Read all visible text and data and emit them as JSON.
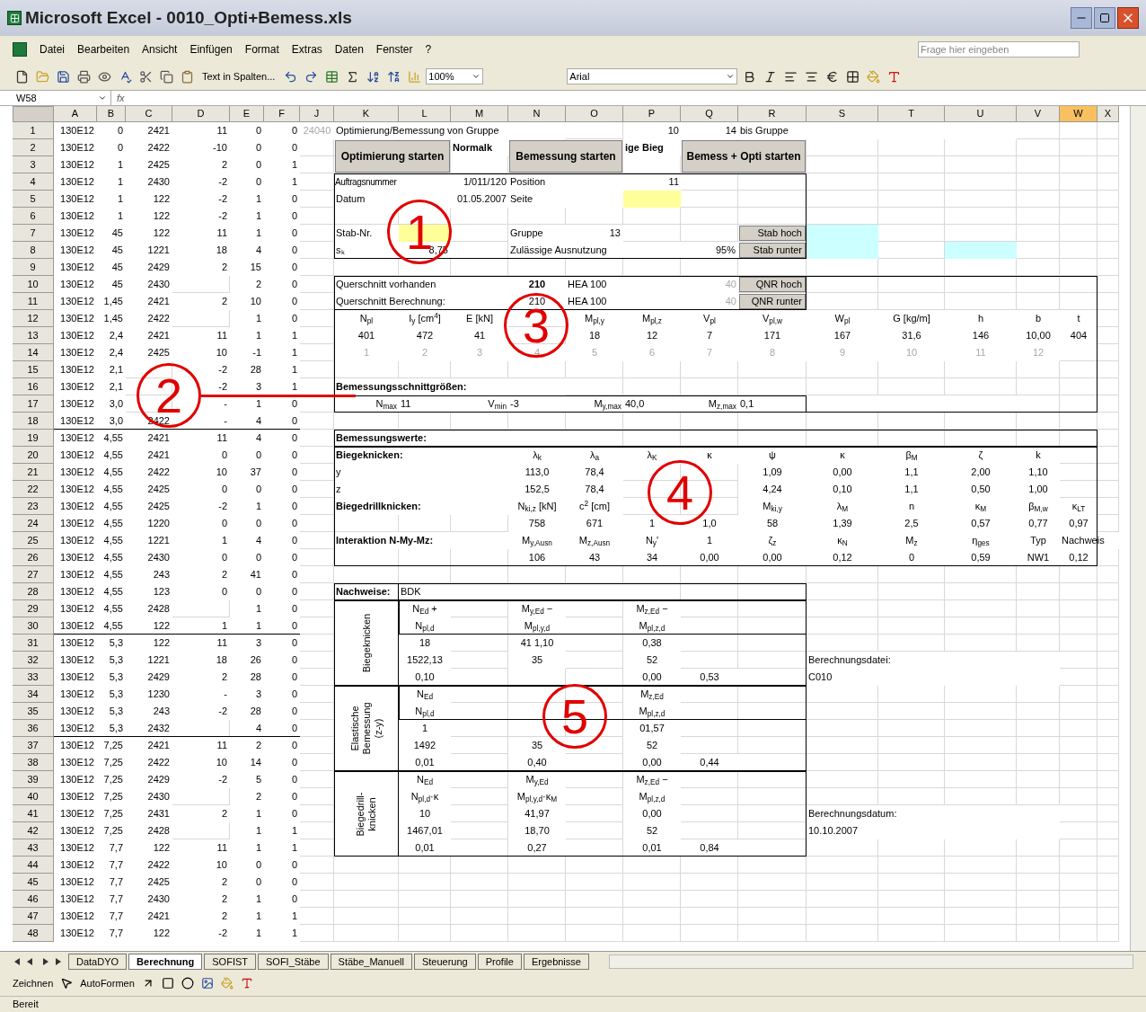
{
  "window": {
    "title": "Microsoft Excel - 0010_Opti+Bemess.xls"
  },
  "menu": [
    "Datei",
    "Bearbeiten",
    "Ansicht",
    "Einfügen",
    "Format",
    "Extras",
    "Daten",
    "Fenster",
    "?"
  ],
  "help_box": {
    "placeholder": "Frage hier eingeben"
  },
  "toolbar": {
    "text_button": "Text in Spalten...",
    "zoom": "100%",
    "font": "Arial"
  },
  "name_box": "W58",
  "formula_prefix": "fx",
  "sheet": {
    "columns": [
      {
        "label": "A",
        "selected": false
      },
      {
        "label": "B",
        "selected": false
      },
      {
        "label": "C",
        "selected": false
      },
      {
        "label": "D",
        "selected": false
      },
      {
        "label": "E",
        "selected": false
      },
      {
        "label": "F",
        "selected": false
      },
      {
        "label": "J",
        "selected": false
      },
      {
        "label": "K",
        "selected": false
      },
      {
        "label": "L",
        "selected": false
      },
      {
        "label": "M",
        "selected": false
      },
      {
        "label": "N",
        "selected": false
      },
      {
        "label": "O",
        "selected": false
      },
      {
        "label": "P",
        "selected": false
      },
      {
        "label": "Q",
        "selected": false
      },
      {
        "label": "R",
        "selected": false
      },
      {
        "label": "S",
        "selected": false
      },
      {
        "label": "T",
        "selected": false
      },
      {
        "label": "U",
        "selected": false
      },
      {
        "label": "V",
        "selected": false
      },
      {
        "label": "W",
        "selected": true
      },
      {
        "label": "X",
        "selected": false
      }
    ],
    "rows": [
      {
        "number": "1",
        "cells": [
          {
            "text": "130E12"
          },
          {
            "text": "0"
          },
          {
            "text": "2421"
          },
          {
            "text": "11"
          },
          {
            "text": "0"
          },
          {
            "text": "0"
          },
          {
            "text": "24040",
            "kind": "faint"
          },
          {
            "text": "Optimierung/Bemessung von Gruppe",
            "kind": "label"
          },
          {},
          {},
          {},
          {},
          {
            "text": "10",
            "kind": "input"
          },
          {
            "text": "14",
            "kind": "input"
          },
          {
            "text": "bis Gruppe",
            "kind": "label"
          }
        ]
      },
      {
        "number": "2",
        "cells": [
          {
            "text": "130E12"
          },
          {
            "text": "0"
          },
          {
            "text": "2422"
          },
          {
            "text": "-10"
          },
          {
            "text": "0"
          },
          {
            "text": "0"
          },
          {},
          {
            "text": "Optimierung starten",
            "kind": "button"
          },
          {},
          {
            "text": "Normalk",
            "kind": "bold"
          },
          {
            "text": "Bemessung starten",
            "kind": "button"
          },
          {},
          {
            "text": "ige Bieg",
            "kind": "bold"
          },
          {
            "text": "Bemess + Opti starten",
            "kind": "button"
          }
        ]
      },
      {
        "number": "3",
        "cells": [
          {
            "text": "130E12"
          },
          {
            "text": "1"
          },
          {
            "text": "2425"
          },
          {
            "text": "2"
          },
          {
            "text": "0"
          },
          {
            "text": "1"
          }
        ]
      },
      {
        "number": "4",
        "cells": [
          {
            "text": "130E12"
          },
          {
            "text": "1"
          },
          {
            "text": "2430"
          },
          {
            "text": "-2"
          },
          {
            "text": "0"
          },
          {
            "text": "1"
          },
          {},
          {
            "text": "Auftragsnummer",
            "kind": "small-label"
          },
          {
            "text": "1/011/120",
            "kind": "input-wide"
          },
          {},
          {
            "text": "Position",
            "kind": "label"
          },
          {},
          {
            "text": "11",
            "kind": "input"
          }
        ]
      },
      {
        "number": "5",
        "cells": [
          {
            "text": "130E12"
          },
          {
            "text": "1"
          },
          {
            "text": "122"
          },
          {
            "text": "-2"
          },
          {
            "text": "1"
          },
          {
            "text": "0"
          },
          {},
          {
            "text": "Datum",
            "kind": "label"
          },
          {
            "text": "01.05.2007",
            "kind": "input-wide"
          },
          {},
          {
            "text": "Seite",
            "kind": "label"
          },
          {},
          {
            "kind": "input"
          }
        ]
      },
      {
        "number": "6",
        "cells": [
          {
            "text": "130E12"
          },
          {
            "text": "1"
          },
          {
            "text": "122"
          },
          {
            "text": "-2"
          },
          {
            "text": "1"
          },
          {
            "text": "0"
          }
        ]
      },
      {
        "number": "7",
        "cells": [
          {
            "text": "130E12"
          },
          {
            "text": "45"
          },
          {
            "text": "122"
          },
          {
            "text": "11"
          },
          {
            "text": "1"
          },
          {
            "text": "0"
          },
          {},
          {
            "text": "Stab-Nr.",
            "kind": "label"
          },
          {
            "kind": "input"
          },
          {},
          {
            "text": "Gruppe",
            "kind": "label"
          },
          {
            "text": "13"
          },
          {},
          {},
          {
            "text": "Stab hoch",
            "kind": "small-button"
          },
          {
            "kind": "highlight"
          }
        ]
      },
      {
        "number": "8",
        "cells": [
          {
            "text": "130E12"
          },
          {
            "text": "45"
          },
          {
            "text": "1221"
          },
          {
            "text": "18"
          },
          {
            "text": "4"
          },
          {
            "text": "0"
          },
          {},
          {
            "text": "sₖ",
            "kind": "label"
          },
          {
            "text": "8,75"
          },
          {},
          {
            "text": "Zulässige Ausnutzung",
            "kind": "label"
          },
          {},
          {},
          {
            "text": "95%"
          },
          {
            "text": "Stab runter",
            "kind": "small-button"
          },
          {
            "kind": "highlight"
          },
          {},
          {
            "kind": "highlight"
          }
        ]
      },
      {
        "number": "9",
        "cells": [
          {
            "text": "130E12"
          },
          {
            "text": "45"
          },
          {
            "text": "2429"
          },
          {
            "text": "2"
          },
          {
            "text": "15"
          },
          {
            "text": "0"
          }
        ]
      },
      {
        "number": "10",
        "cells": [
          {
            "text": "130E12"
          },
          {
            "text": "45"
          },
          {
            "text": "2430"
          },
          {},
          {
            "text": "2"
          },
          {
            "text": "0"
          },
          {},
          {
            "text": "Querschnitt vorhanden",
            "kind": "label"
          },
          {},
          {},
          {
            "text": "210",
            "kind": "bold-center"
          },
          {
            "text": "HEA 100",
            "kind": "label"
          },
          {},
          {
            "text": "40",
            "kind": "faint-number"
          },
          {
            "text": "QNR hoch",
            "kind": "small-button"
          }
        ]
      },
      {
        "number": "11",
        "cells": [
          {
            "text": "130E12"
          },
          {
            "text": "1,45"
          },
          {
            "text": "2421"
          },
          {
            "text": "2"
          },
          {
            "text": "10"
          },
          {
            "text": "0"
          },
          {},
          {
            "text": "Querschnitt Berechnung:",
            "kind": "label"
          },
          {},
          {},
          {
            "text": "210",
            "kind": "input-center"
          },
          {
            "text": "HEA 100",
            "kind": "label"
          },
          {},
          {
            "text": "40",
            "kind": "faint-number"
          },
          {
            "text": "QNR runter",
            "kind": "small-button"
          }
        ]
      },
      {
        "number": "12",
        "cells": [
          {
            "text": "130E12"
          },
          {
            "text": "1,45"
          },
          {
            "text": "2422"
          },
          {},
          {
            "text": "1"
          },
          {
            "text": "0"
          },
          {},
          {
            "text": "N$_{pl}$",
            "kind": "center"
          },
          {
            "text": "I$_{y}$ [cm$^{4}$]",
            "kind": "center"
          },
          {
            "text": "E [kN]",
            "kind": "center"
          },
          {},
          {
            "text": "M$_{pl,y}$",
            "kind": "center"
          },
          {
            "text": "M$_{pl,z}$",
            "kind": "center"
          },
          {
            "text": "V$_{pl}$",
            "kind": "center"
          },
          {
            "text": "V$_{pl,w}$",
            "kind": "center"
          },
          {
            "text": "W$_{pl}$",
            "kind": "center"
          },
          {
            "text": "G [kg/m]",
            "kind": "center"
          },
          {
            "text": "h",
            "kind": "center"
          },
          {
            "text": "b",
            "kind": "center"
          },
          {
            "text": "t",
            "kind": "center"
          }
        ]
      },
      {
        "number": "13",
        "cells": [
          {
            "text": "130E12"
          },
          {
            "text": "2,4"
          },
          {
            "text": "2421"
          },
          {
            "text": "11"
          },
          {
            "text": "1"
          },
          {
            "text": "1"
          },
          {},
          {
            "text": "401",
            "kind": "center"
          },
          {
            "text": "472",
            "kind": "center"
          },
          {
            "text": "41",
            "kind": "center"
          },
          {},
          {
            "text": "18",
            "kind": "center"
          },
          {
            "text": "12",
            "kind": "center"
          },
          {
            "text": "7",
            "kind": "center"
          },
          {
            "text": "171",
            "kind": "center"
          },
          {
            "text": "167",
            "kind": "center"
          },
          {
            "text": "31,6",
            "kind": "center"
          },
          {
            "text": "146",
            "kind": "center"
          },
          {
            "text": "10,00",
            "kind": "center"
          },
          {
            "text": "404",
            "kind": "center"
          }
        ]
      },
      {
        "number": "14",
        "cells": [
          {
            "text": "130E12"
          },
          {
            "text": "2,4"
          },
          {
            "text": "2425"
          },
          {
            "text": "10"
          },
          {
            "text": "-1"
          },
          {
            "text": "1"
          },
          {},
          {
            "text": "1",
            "kind": "faint"
          },
          {
            "text": "2",
            "kind": "faint"
          },
          {
            "text": "3",
            "kind": "faint"
          },
          {
            "text": "4",
            "kind": "faint"
          },
          {
            "text": "5",
            "kind": "faint"
          },
          {
            "text": "6",
            "kind": "faint"
          },
          {
            "text": "7",
            "kind": "faint"
          },
          {
            "text": "8",
            "kind": "faint"
          },
          {
            "text": "9",
            "kind": "faint"
          },
          {
            "text": "10",
            "kind": "faint"
          },
          {
            "text": "11",
            "kind": "faint"
          },
          {
            "text": "12",
            "kind": "faint"
          }
        ]
      },
      {
        "number": "15",
        "cells": [
          {
            "text": "130E12"
          },
          {
            "text": "2,1"
          },
          {},
          {
            "text": "-2"
          },
          {
            "text": "28"
          },
          {
            "text": "1"
          }
        ]
      },
      {
        "number": "16",
        "cells": [
          {
            "text": "130E12"
          },
          {
            "text": "2,1"
          },
          {},
          {
            "text": "-2"
          },
          {
            "text": "3"
          },
          {
            "text": "1"
          },
          {},
          {
            "text": "Bemessungsschnittgrößen:",
            "kind": "bold"
          }
        ]
      },
      {
        "number": "17",
        "cells": [
          {
            "text": "130E12"
          },
          {
            "text": "3,0"
          },
          {},
          {
            "text": "-"
          },
          {
            "text": "1"
          },
          {
            "text": "0"
          },
          {},
          {
            "text": "N$_{max}$",
            "kind": "right"
          },
          {
            "text": "11",
            "kind": "label"
          },
          {
            "text": "V$_{min}$",
            "kind": "right"
          },
          {
            "text": "-3",
            "kind": "label"
          },
          {
            "text": "M$_{y,max}$",
            "kind": "right"
          },
          {
            "text": "40,0",
            "kind": "label"
          },
          {
            "text": "M$_{z,max}$",
            "kind": "right"
          },
          {
            "text": "0,1",
            "kind": "label"
          }
        ]
      },
      {
        "number": "18",
        "cells": [
          {
            "text": "130E12"
          },
          {
            "text": "3,0"
          },
          {
            "text": "2422"
          },
          {
            "text": "-"
          },
          {
            "text": "4"
          },
          {
            "text": "0"
          }
        ]
      },
      {
        "number": "19",
        "cells": [
          {
            "text": "130E12"
          },
          {
            "text": "4,55"
          },
          {
            "text": "2421"
          },
          {
            "text": "11"
          },
          {
            "text": "4"
          },
          {
            "text": "0"
          },
          {},
          {
            "text": "Bemessungswerte:",
            "kind": "bold"
          }
        ]
      },
      {
        "number": "20",
        "cells": [
          {
            "text": "130E12"
          },
          {
            "text": "4,55"
          },
          {
            "text": "2421"
          },
          {
            "text": "0"
          },
          {
            "text": "0"
          },
          {
            "text": "0"
          },
          {},
          {
            "text": "Biegeknicken:",
            "kind": "bold"
          },
          {},
          {},
          {
            "text": "λ$_{k}$",
            "kind": "center"
          },
          {
            "text": "λ$_{a}$",
            "kind": "center"
          },
          {
            "text": "λ$_{K}$",
            "kind": "center"
          },
          {
            "text": "κ",
            "kind": "center"
          },
          {
            "text": "ψ",
            "kind": "center"
          },
          {
            "text": "κ",
            "kind": "center"
          },
          {
            "text": "β$_{M}$",
            "kind": "center"
          },
          {
            "text": "ζ",
            "kind": "center"
          },
          {
            "text": "k",
            "kind": "center"
          }
        ]
      },
      {
        "number": "21",
        "cells": [
          {
            "text": "130E12"
          },
          {
            "text": "4,55"
          },
          {
            "text": "2422"
          },
          {
            "text": "10"
          },
          {
            "text": "37"
          },
          {
            "text": "0"
          },
          {},
          {
            "text": "y",
            "kind": "label"
          },
          {},
          {},
          {
            "text": "113,0",
            "kind": "center"
          },
          {
            "text": "78,4",
            "kind": "center"
          },
          {},
          {},
          {
            "text": "1,09",
            "kind": "center"
          },
          {
            "text": "0,00",
            "kind": "center"
          },
          {
            "text": "1,1",
            "kind": "center"
          },
          {
            "text": "2,00",
            "kind": "center"
          },
          {
            "text": "1,10",
            "kind": "center"
          }
        ]
      },
      {
        "number": "22",
        "cells": [
          {
            "text": "130E12"
          },
          {
            "text": "4,55"
          },
          {
            "text": "2425"
          },
          {
            "text": "0"
          },
          {
            "text": "0"
          },
          {
            "text": "0"
          },
          {},
          {
            "text": "z",
            "kind": "label"
          },
          {},
          {},
          {
            "text": "152,5",
            "kind": "center"
          },
          {
            "text": "78,4",
            "kind": "center"
          },
          {},
          {},
          {
            "text": "4,24",
            "kind": "center"
          },
          {
            "text": "0,10",
            "kind": "center"
          },
          {
            "text": "1,1",
            "kind": "center"
          },
          {
            "text": "0,50",
            "kind": "center"
          },
          {
            "text": "1,00",
            "kind": "center"
          }
        ]
      },
      {
        "number": "23",
        "cells": [
          {
            "text": "130E12"
          },
          {
            "text": "4,55"
          },
          {
            "text": "2425"
          },
          {
            "text": "-2"
          },
          {
            "text": "1"
          },
          {
            "text": "0"
          },
          {},
          {
            "text": "Biegedrillknicken:",
            "kind": "bold"
          },
          {},
          {},
          {
            "text": "N$_{ki,z}$ [kN]",
            "kind": "center"
          },
          {
            "text": "c$^{2}$ [cm]",
            "kind": "center"
          },
          {},
          {},
          {
            "text": "M$_{ki,y}$",
            "kind": "center"
          },
          {
            "text": "λ$_{M}$",
            "kind": "center"
          },
          {
            "text": "n",
            "kind": "center"
          },
          {
            "text": "κ$_{M}$",
            "kind": "center"
          },
          {
            "text": "β$_{M,w}$",
            "kind": "center"
          },
          {
            "text": "κ$_{LT}$",
            "kind": "center"
          }
        ]
      },
      {
        "number": "24",
        "cells": [
          {
            "text": "130E12"
          },
          {
            "text": "4,55"
          },
          {
            "text": "1220"
          },
          {
            "text": "0"
          },
          {
            "text": "0"
          },
          {
            "text": "0"
          },
          {},
          {},
          {},
          {},
          {
            "text": "758",
            "kind": "center"
          },
          {
            "text": "671",
            "kind": "center"
          },
          {
            "text": "1",
            "kind": "center"
          },
          {
            "text": "1,0",
            "kind": "center"
          },
          {
            "text": "58",
            "kind": "center"
          },
          {
            "text": "1,39",
            "kind": "center"
          },
          {
            "text": "2,5",
            "kind": "center"
          },
          {
            "text": "0,57",
            "kind": "center"
          },
          {
            "text": "0,77",
            "kind": "center"
          },
          {
            "text": "0,97",
            "kind": "center"
          }
        ]
      },
      {
        "number": "25",
        "cells": [
          {
            "text": "130E12"
          },
          {
            "text": "4,55"
          },
          {
            "text": "1221"
          },
          {
            "text": "1"
          },
          {
            "text": "4"
          },
          {
            "text": "0"
          },
          {},
          {
            "text": "Interaktion N-My-Mz:",
            "kind": "bold"
          },
          {},
          {},
          {
            "text": "M$_{y,Ausn}$",
            "kind": "center"
          },
          {
            "text": "M$_{z,Ausn}$",
            "kind": "center"
          },
          {
            "text": "N$_{y}$'",
            "kind": "center"
          },
          {
            "text": "1",
            "kind": "center"
          },
          {
            "text": "ζ$_{z}$",
            "kind": "center"
          },
          {
            "text": "κ$_{N}$",
            "kind": "center"
          },
          {
            "text": "M$_{z}$",
            "kind": "center"
          },
          {
            "text": "η$_{ges}$",
            "kind": "center"
          },
          {
            "text": "Typ",
            "kind": "center"
          },
          {
            "text": "Nachweis",
            "kind": "label"
          }
        ]
      },
      {
        "number": "26",
        "cells": [
          {
            "text": "130E12"
          },
          {
            "text": "4,55"
          },
          {
            "text": "2430"
          },
          {
            "text": "0"
          },
          {
            "text": "0"
          },
          {
            "text": "0"
          },
          {},
          {},
          {},
          {},
          {
            "text": "106",
            "kind": "center"
          },
          {
            "text": "43",
            "kind": "center"
          },
          {
            "text": "34",
            "kind": "center"
          },
          {
            "text": "0,00",
            "kind": "center"
          },
          {
            "text": "0,00",
            "kind": "center"
          },
          {
            "text": "0,12",
            "kind": "center"
          },
          {
            "text": "0",
            "kind": "center"
          },
          {
            "text": "0,59",
            "kind": "center"
          },
          {
            "text": "NW1",
            "kind": "center"
          },
          {
            "text": "0,12",
            "kind": "center"
          }
        ]
      },
      {
        "number": "27",
        "cells": [
          {
            "text": "130E12"
          },
          {
            "text": "4,55"
          },
          {
            "text": "243"
          },
          {
            "text": "2"
          },
          {
            "text": "41"
          },
          {
            "text": "0"
          }
        ]
      },
      {
        "number": "28",
        "cells": [
          {
            "text": "130E12"
          },
          {
            "text": "4,55"
          },
          {
            "text": "123"
          },
          {
            "text": "0"
          },
          {
            "text": "0"
          },
          {
            "text": "0"
          },
          {},
          {
            "text": "Nachweise:",
            "kind": "bold"
          },
          {
            "text": "BDK",
            "kind": "label"
          }
        ]
      },
      {
        "number": "29",
        "cells": [
          {
            "text": "130E12"
          },
          {
            "text": "4,55"
          },
          {
            "text": "2428"
          },
          {},
          {
            "text": "1"
          },
          {
            "text": "0"
          },
          {},
          {},
          {
            "text": "N$_{Ed}$ +",
            "kind": "center"
          },
          {},
          {
            "text": "M$_{y,Ed}$ −",
            "kind": "center"
          },
          {},
          {
            "text": "M$_{z,Ed}$ −",
            "kind": "center"
          }
        ]
      },
      {
        "number": "30",
        "cells": [
          {
            "text": "130E12"
          },
          {
            "text": "4,55"
          },
          {
            "text": "122"
          },
          {
            "text": "1"
          },
          {
            "text": "1"
          },
          {
            "text": "0"
          },
          {},
          {},
          {
            "text": "N$_{pl,d}$",
            "kind": "center"
          },
          {},
          {
            "text": "M$_{pl,y,d}$",
            "kind": "center"
          },
          {},
          {
            "text": "M$_{pl,z,d}$",
            "kind": "center"
          }
        ]
      },
      {
        "number": "31",
        "cells": [
          {
            "text": "130E12"
          },
          {
            "text": "5,3"
          },
          {
            "text": "122"
          },
          {
            "text": "11"
          },
          {
            "text": "3"
          },
          {
            "text": "0"
          },
          {},
          {
            "text": "Biegeknicken",
            "kind": "vertical"
          },
          {
            "text": "18",
            "kind": "center"
          },
          {},
          {
            "text": "41 1,10",
            "kind": "center"
          },
          {},
          {
            "text": "0,38",
            "kind": "center"
          }
        ]
      },
      {
        "number": "32",
        "cells": [
          {
            "text": "130E12"
          },
          {
            "text": "5,3"
          },
          {
            "text": "1221"
          },
          {
            "text": "18"
          },
          {
            "text": "26"
          },
          {
            "text": "0"
          },
          {},
          {},
          {
            "text": "1522,13",
            "kind": "center"
          },
          {},
          {
            "text": "35",
            "kind": "center"
          },
          {},
          {
            "text": "52",
            "kind": "center"
          },
          {},
          {},
          {
            "text": "Berechnungsdatei:",
            "kind": "label"
          }
        ]
      },
      {
        "number": "33",
        "cells": [
          {
            "text": "130E12"
          },
          {
            "text": "5,3"
          },
          {
            "text": "2429"
          },
          {
            "text": "2"
          },
          {
            "text": "28"
          },
          {
            "text": "0"
          },
          {},
          {},
          {
            "text": "0,10",
            "kind": "center"
          },
          {},
          {},
          {},
          {
            "text": "0,00",
            "kind": "center"
          },
          {
            "text": "0,53",
            "kind": "center"
          },
          {},
          {
            "text": "C010",
            "kind": "label"
          }
        ]
      },
      {
        "number": "34",
        "cells": [
          {
            "text": "130E12"
          },
          {
            "text": "5,3"
          },
          {
            "text": "1230"
          },
          {
            "text": "-"
          },
          {
            "text": "3"
          },
          {
            "text": "0"
          },
          {},
          {},
          {
            "text": "N$_{Ed}$",
            "kind": "center"
          },
          {},
          {},
          {},
          {
            "text": "M$_{z,Ed}$",
            "kind": "center"
          }
        ]
      },
      {
        "number": "35",
        "cells": [
          {
            "text": "130E12"
          },
          {
            "text": "5,3"
          },
          {
            "text": "243"
          },
          {
            "text": "-2"
          },
          {
            "text": "28"
          },
          {
            "text": "0"
          },
          {},
          {},
          {
            "text": "N$_{pl,d}$",
            "kind": "center"
          },
          {},
          {},
          {},
          {
            "text": "M$_{pl,z,d}$",
            "kind": "center"
          }
        ]
      },
      {
        "number": "36",
        "cells": [
          {
            "text": "130E12"
          },
          {
            "text": "5,3"
          },
          {
            "text": "2432"
          },
          {},
          {
            "text": "4"
          },
          {
            "text": "0"
          },
          {},
          {
            "text": "Elastische Bemessung (z-y)",
            "kind": "vertical"
          },
          {
            "text": "1",
            "kind": "center"
          },
          {},
          {},
          {},
          {
            "text": "01,57",
            "kind": "center"
          }
        ]
      },
      {
        "number": "37",
        "cells": [
          {
            "text": "130E12"
          },
          {
            "text": "7,25"
          },
          {
            "text": "2421"
          },
          {
            "text": "11"
          },
          {
            "text": "2"
          },
          {
            "text": "0"
          },
          {},
          {},
          {
            "text": "1492",
            "kind": "center"
          },
          {},
          {
            "text": "35",
            "kind": "center"
          },
          {},
          {
            "text": "52",
            "kind": "center"
          }
        ]
      },
      {
        "number": "38",
        "cells": [
          {
            "text": "130E12"
          },
          {
            "text": "7,25"
          },
          {
            "text": "2422"
          },
          {
            "text": "10"
          },
          {
            "text": "14"
          },
          {
            "text": "0"
          },
          {},
          {},
          {
            "text": "0,01",
            "kind": "center"
          },
          {},
          {
            "text": "0,40",
            "kind": "center"
          },
          {},
          {
            "text": "0,00",
            "kind": "center"
          },
          {
            "text": "0,44",
            "kind": "center"
          }
        ]
      },
      {
        "number": "39",
        "cells": [
          {
            "text": "130E12"
          },
          {
            "text": "7,25"
          },
          {
            "text": "2429"
          },
          {
            "text": "-2"
          },
          {
            "text": "5"
          },
          {
            "text": "0"
          },
          {},
          {},
          {
            "text": "N$_{Ed}$",
            "kind": "center"
          },
          {},
          {
            "text": "M$_{y,Ed}$",
            "kind": "center"
          },
          {},
          {
            "text": "M$_{z,Ed}$ −",
            "kind": "center"
          }
        ]
      },
      {
        "number": "40",
        "cells": [
          {
            "text": "130E12"
          },
          {
            "text": "7,25"
          },
          {
            "text": "2430"
          },
          {},
          {
            "text": "2"
          },
          {
            "text": "0"
          },
          {},
          {},
          {
            "text": "N$_{pl,d}$·κ",
            "kind": "center"
          },
          {},
          {
            "text": "M$_{pl,y,d}$·κ$_{M}$",
            "kind": "center"
          },
          {},
          {
            "text": "M$_{pl,z,d}$",
            "kind": "center"
          }
        ]
      },
      {
        "number": "41",
        "cells": [
          {
            "text": "130E12"
          },
          {
            "text": "7,25"
          },
          {
            "text": "2431"
          },
          {
            "text": "2"
          },
          {
            "text": "1"
          },
          {
            "text": "0"
          },
          {},
          {
            "text": "Biegedrill-knicken",
            "kind": "vertical"
          },
          {
            "text": "10",
            "kind": "center"
          },
          {},
          {
            "text": "41,97",
            "kind": "center"
          },
          {},
          {
            "text": "0,00",
            "kind": "center"
          },
          {},
          {},
          {
            "text": "Berechnungsdatum:",
            "kind": "label"
          }
        ]
      },
      {
        "number": "42",
        "cells": [
          {
            "text": "130E12"
          },
          {
            "text": "7,25"
          },
          {
            "text": "2428"
          },
          {},
          {
            "text": "1"
          },
          {
            "text": "1"
          },
          {},
          {},
          {
            "text": "1467,01",
            "kind": "center"
          },
          {},
          {
            "text": "18,70",
            "kind": "center"
          },
          {},
          {
            "text": "52",
            "kind": "center"
          },
          {},
          {},
          {
            "text": "10.10.2007",
            "kind": "label"
          }
        ]
      },
      {
        "number": "43",
        "cells": [
          {
            "text": "130E12"
          },
          {
            "text": "7,7"
          },
          {
            "text": "122"
          },
          {
            "text": "11"
          },
          {
            "text": "1"
          },
          {
            "text": "1"
          },
          {},
          {},
          {
            "text": "0,01",
            "kind": "center"
          },
          {},
          {
            "text": "0,27",
            "kind": "center"
          },
          {},
          {
            "text": "0,01",
            "kind": "center"
          },
          {
            "text": "0,84",
            "kind": "center"
          }
        ]
      },
      {
        "number": "44",
        "cells": [
          {
            "text": "130E12"
          },
          {
            "text": "7,7"
          },
          {
            "text": "2422"
          },
          {
            "text": "10"
          },
          {
            "text": "0"
          },
          {
            "text": "0"
          }
        ]
      },
      {
        "number": "45",
        "cells": [
          {
            "text": "130E12"
          },
          {
            "text": "7,7"
          },
          {
            "text": "2425"
          },
          {
            "text": "2"
          },
          {
            "text": "0"
          },
          {
            "text": "0"
          }
        ]
      },
      {
        "number": "46",
        "cells": [
          {
            "text": "130E12"
          },
          {
            "text": "7,7"
          },
          {
            "text": "2430"
          },
          {
            "text": "2"
          },
          {
            "text": "1"
          },
          {
            "text": "0"
          }
        ]
      },
      {
        "number": "47",
        "cells": [
          {
            "text": "130E12"
          },
          {
            "text": "7,7"
          },
          {
            "text": "2421"
          },
          {
            "text": "2"
          },
          {
            "text": "1"
          },
          {
            "text": "1"
          }
        ]
      },
      {
        "number": "48",
        "cells": [
          {
            "text": "130E12"
          },
          {
            "text": "7,7"
          },
          {
            "text": "122"
          },
          {
            "text": "-2"
          },
          {
            "text": "1"
          },
          {
            "text": "1"
          }
        ]
      }
    ]
  },
  "callouts": [
    {
      "label": "1"
    },
    {
      "label": "2"
    },
    {
      "label": "3"
    },
    {
      "label": "4"
    },
    {
      "label": "5"
    }
  ],
  "sheet_tabs": [
    {
      "label": "DataDYO",
      "selected": false
    },
    {
      "label": "Berechnung",
      "selected": true
    },
    {
      "label": "SOFIST",
      "selected": false
    },
    {
      "label": "SOFI_Stäbe",
      "selected": false
    },
    {
      "label": "Stäbe_Manuell",
      "selected": false
    },
    {
      "label": "Steuerung",
      "selected": false
    },
    {
      "label": "Profile",
      "selected": false
    },
    {
      "label": "Ergebnisse",
      "selected": false
    }
  ],
  "drawing_toolbar": {
    "draw": "Zeichnen",
    "autoshapes": "AutoFormen"
  },
  "status_bar": {
    "text": "Bereit"
  }
}
